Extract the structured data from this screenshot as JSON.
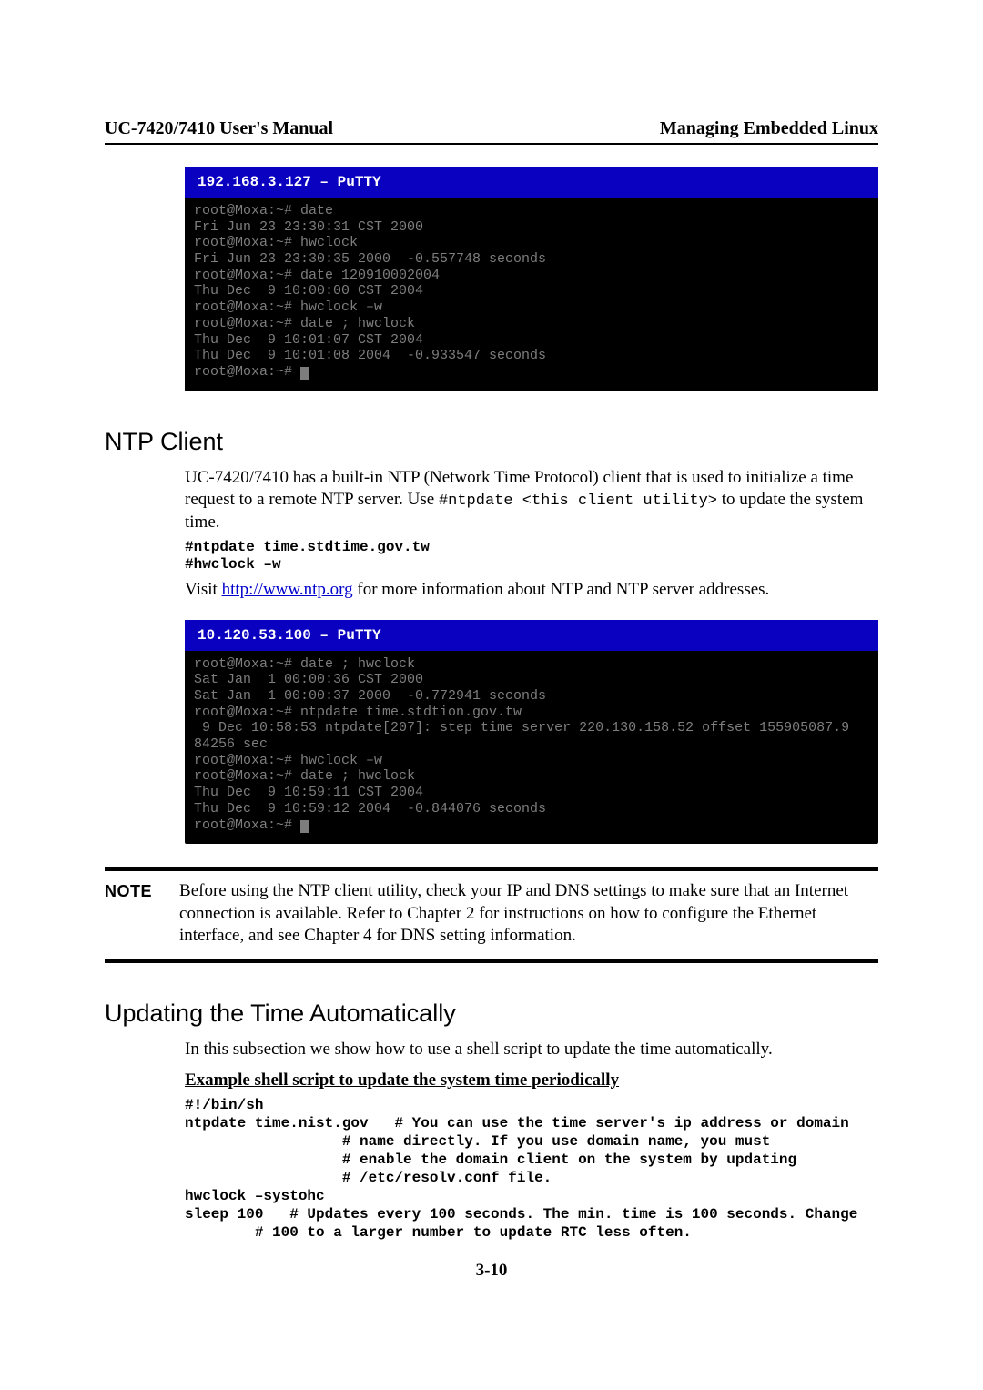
{
  "header": {
    "left": "UC-7420/7410 User's Manual",
    "right": "Managing Embedded Linux"
  },
  "terminal1": {
    "title": "  192.168.3.127 – PuTTY",
    "lines": "root@Moxa:~# date\nFri Jun 23 23:30:31 CST 2000\nroot@Moxa:~# hwclock\nFri Jun 23 23:30:35 2000  -0.557748 seconds\nroot@Moxa:~# date 120910002004\nThu Dec  9 10:00:00 CST 2004\nroot@Moxa:~# hwclock –w\nroot@Moxa:~# date ; hwclock\nThu Dec  9 10:01:07 CST 2004\nThu Dec  9 10:01:08 2004  -0.933547 seconds\nroot@Moxa:~# "
  },
  "sections": {
    "ntp_title": "NTP Client",
    "ntp_para1_a": "UC-7420/7410 has a built-in NTP (Network Time Protocol) client that is used to initialize a time request to a remote NTP server. Use ",
    "ntp_inline": "#ntpdate <this client utility>",
    "ntp_para1_b": " to update the system time.",
    "ntp_cmds": "#ntpdate time.stdtime.gov.tw\n#hwclock –w",
    "ntp_para2_a": "Visit ",
    "ntp_link": "http://www.ntp.org",
    "ntp_para2_b": " for more information about NTP and NTP server addresses."
  },
  "terminal2": {
    "title": "  10.120.53.100 – PuTTY",
    "lines": "root@Moxa:~# date ; hwclock\nSat Jan  1 00:00:36 CST 2000\nSat Jan  1 00:00:37 2000  -0.772941 seconds\nroot@Moxa:~# ntpdate time.stdtion.gov.tw\n 9 Dec 10:58:53 ntpdate[207]: step time server 220.130.158.52 offset 155905087.9\n84256 sec\nroot@Moxa:~# hwclock –w\nroot@Moxa:~# date ; hwclock\nThu Dec  9 10:59:11 CST 2004\nThu Dec  9 10:59:12 2004  -0.844076 seconds\nroot@Moxa:~# "
  },
  "note": {
    "label": "NOTE",
    "text": "Before using the NTP client utility, check your IP and DNS settings to make sure that an Internet connection is available. Refer to Chapter 2 for instructions on how to configure the Ethernet interface, and see Chapter 4 for DNS setting information."
  },
  "update": {
    "title": "Updating the Time Automatically",
    "intro": "In this subsection we show how to use a shell script to update the time automatically.",
    "subhead": "Example shell script to update the system time periodically",
    "script": "#!/bin/sh\nntpdate time.nist.gov   # You can use the time server's ip address or domain\n                  # name directly. If you use domain name, you must\n                  # enable the domain client on the system by updating\n                  # /etc/resolv.conf file.\nhwclock –systohc\nsleep 100   # Updates every 100 seconds. The min. time is 100 seconds. Change\n        # 100 to a larger number to update RTC less often."
  },
  "page_number": "3-10"
}
